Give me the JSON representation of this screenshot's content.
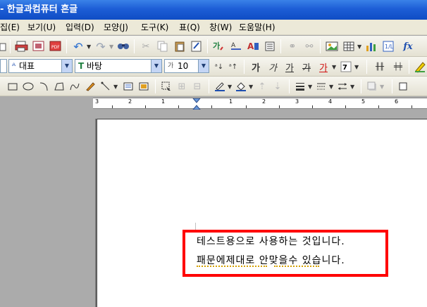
{
  "title": "- 한글과컴퓨터 흔글",
  "menu": [
    {
      "label": "집(E)",
      "key": "edit"
    },
    {
      "label": "보기(U)",
      "key": "view"
    },
    {
      "label": "입력(D)",
      "key": "input"
    },
    {
      "label": "모양(J)",
      "key": "format"
    },
    {
      "label": "도구(K)",
      "key": "tools"
    },
    {
      "label": "표(Q)",
      "key": "table"
    },
    {
      "label": "창(W)",
      "key": "window"
    },
    {
      "label": "도움말(H)",
      "key": "help"
    }
  ],
  "format_bar": {
    "style_value": "대표",
    "font_value": "바탕",
    "size_value": "10",
    "bold_label": "가",
    "italic_label": "가",
    "underline_label": "가",
    "strike_label": "가",
    "color_label": "가"
  },
  "ruler": {
    "marks": [
      "3",
      "2",
      "1",
      "1",
      "2",
      "3",
      "4",
      "5",
      "6"
    ]
  },
  "document": {
    "lines": [
      "테스트용으로 사용하는 것입니다.",
      "패문에제대로 안맞을수 있습니다."
    ]
  },
  "colors": {
    "highlight": "#ff0000",
    "titlebar": "#1d5ed6",
    "toolbar": "#ece9d8"
  }
}
